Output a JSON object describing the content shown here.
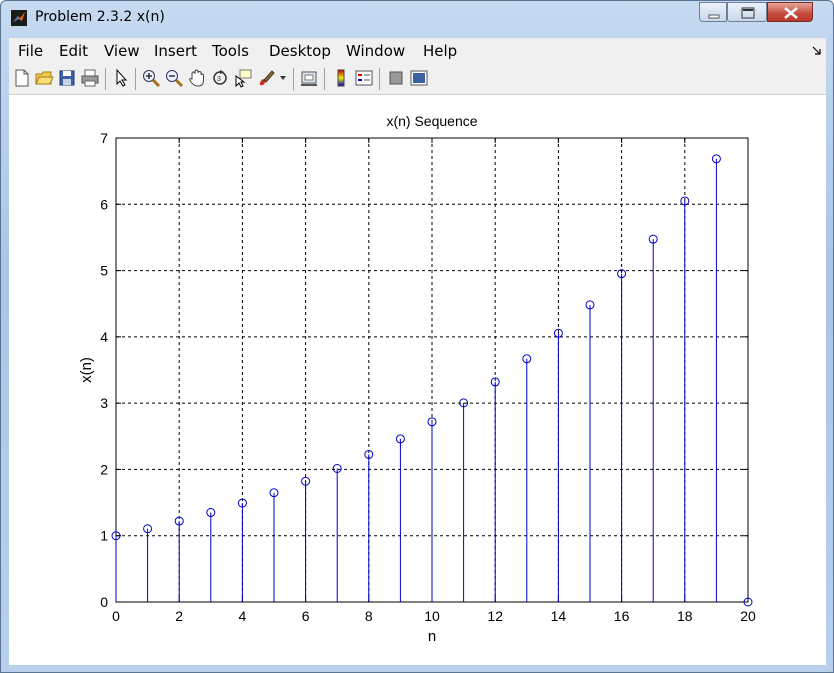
{
  "window": {
    "title": "Problem 2.3.2 x(n)"
  },
  "menu": [
    "File",
    "Edit",
    "View",
    "Insert",
    "Tools",
    "Desktop",
    "Window",
    "Help"
  ],
  "toolbar": [
    "new-figure",
    "open-file",
    "save",
    "print",
    "edit-plot",
    "zoom-in",
    "zoom-out",
    "pan",
    "rotate-3d",
    "data-cursor",
    "brush",
    "link-plot",
    "colorbar",
    "legend",
    "hide-plot-tools",
    "show-plot-tools"
  ],
  "chart_data": {
    "type": "stem",
    "title": "x(n) Sequence",
    "xlabel": "n",
    "ylabel": "x(n)",
    "xlim": [
      0,
      20
    ],
    "ylim": [
      0,
      7
    ],
    "grid": true,
    "x": [
      0,
      1,
      2,
      3,
      4,
      5,
      6,
      7,
      8,
      9,
      10,
      11,
      12,
      13,
      14,
      15,
      16,
      17,
      18,
      19,
      20
    ],
    "values": [
      1.0,
      1.105,
      1.221,
      1.35,
      1.492,
      1.649,
      1.822,
      2.014,
      2.226,
      2.46,
      2.718,
      3.004,
      3.32,
      3.669,
      4.055,
      4.482,
      4.953,
      5.474,
      6.05,
      6.686,
      0
    ],
    "xticks": [
      0,
      2,
      4,
      6,
      8,
      10,
      12,
      14,
      16,
      18,
      20
    ],
    "yticks": [
      0,
      1,
      2,
      3,
      4,
      5,
      6,
      7
    ],
    "color": "#0000cc"
  }
}
